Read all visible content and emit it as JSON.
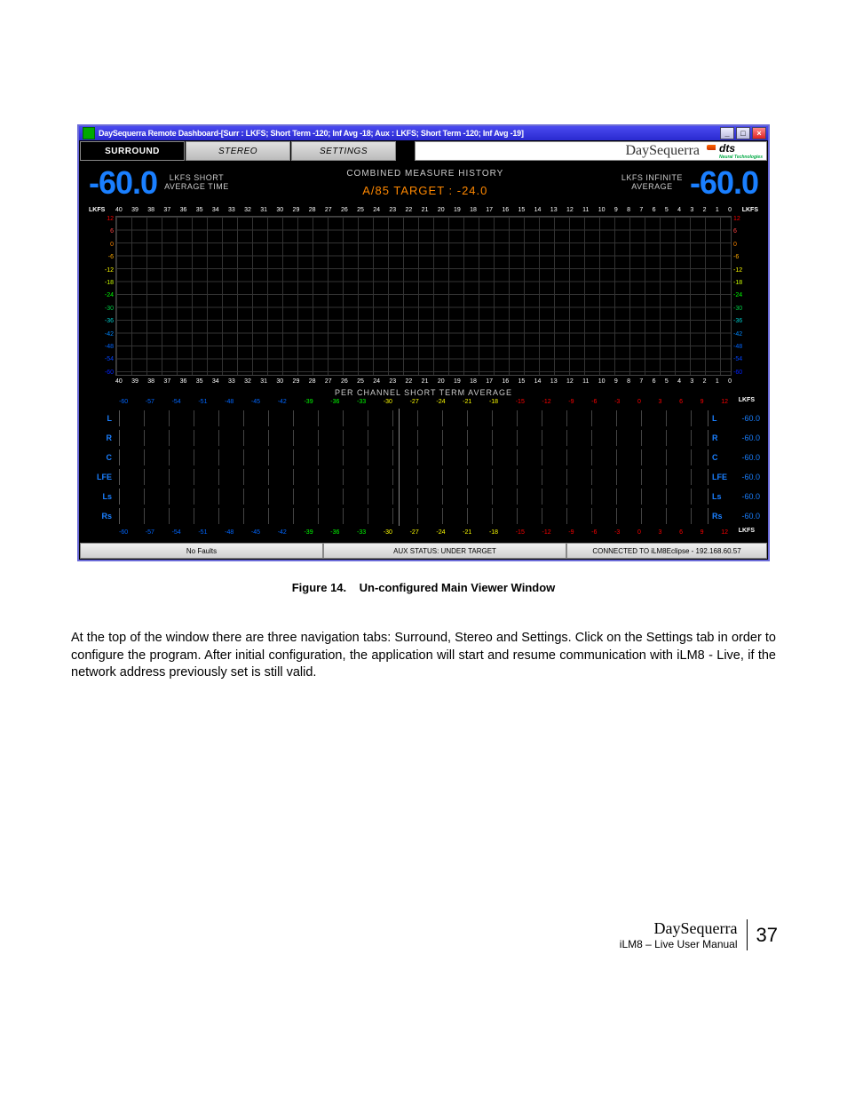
{
  "doc": {
    "caption_label": "Figure 14.",
    "caption_text": "Un-configured Main Viewer Window",
    "body_paragraph": "At the top of the window there are three navigation tabs: Surround, Stereo and Settings. Click on the Settings tab in order to configure the program. After initial configuration, the application will start and resume communication with iLM8 - Live, if the network address previously set is still valid.",
    "footer_brand": "DaySequerra",
    "footer_sub": "iLM8 – Live User Manual",
    "page_number": "37"
  },
  "window": {
    "title": "DaySequerra Remote Dashboard-[Surr : LKFS; Short Term -120; Inf Avg -18; Aux : LKFS; Short Term -120; Inf Avg -19]",
    "ctrl_min": "_",
    "ctrl_max": "□",
    "ctrl_close": "×"
  },
  "tabs": {
    "surround": "SURROUND",
    "stereo": "STEREO",
    "settings": "SETTINGS"
  },
  "branding": {
    "name": "DaySequerra",
    "partner": "dts",
    "partner_sub": "Neural Technologies"
  },
  "readings": {
    "short_label_l1": "LKFS SHORT",
    "short_label_l2": "AVERAGE TIME",
    "short_value": "-60.0",
    "inf_label_l1": "LKFS INFINITE",
    "inf_label_l2": "AVERAGE",
    "inf_value": "-60.0",
    "center_title": "COMBINED MEASURE HISTORY",
    "center_target": "A/85  TARGET : -24.0"
  },
  "graph": {
    "axis_unit": "LKFS",
    "x_ticks": [
      "40",
      "39",
      "38",
      "37",
      "36",
      "35",
      "34",
      "33",
      "32",
      "31",
      "30",
      "29",
      "28",
      "27",
      "26",
      "25",
      "24",
      "23",
      "22",
      "21",
      "20",
      "19",
      "18",
      "17",
      "16",
      "15",
      "14",
      "13",
      "12",
      "11",
      "10",
      "9",
      "8",
      "7",
      "6",
      "5",
      "4",
      "3",
      "2",
      "1",
      "0"
    ],
    "y_ticks": [
      "12",
      "6",
      "0",
      "-6",
      "-12",
      "-18",
      "-24",
      "-30",
      "-36",
      "-42",
      "-48",
      "-54",
      "-60"
    ]
  },
  "per_channel": {
    "title": "PER CHANNEL SHORT TERM AVERAGE",
    "unit": "LKFS",
    "scale": [
      "-60",
      "-57",
      "-54",
      "-51",
      "-48",
      "-45",
      "-42",
      "-39",
      "-36",
      "-33",
      "-30",
      "-27",
      "-24",
      "-21",
      "-18",
      "-15",
      "-12",
      "-9",
      "-6",
      "-3",
      "0",
      "3",
      "6",
      "9",
      "12"
    ],
    "channels": [
      {
        "name": "L",
        "value": "-60.0"
      },
      {
        "name": "R",
        "value": "-60.0"
      },
      {
        "name": "C",
        "value": "-60.0"
      },
      {
        "name": "LFE",
        "value": "-60.0"
      },
      {
        "name": "Ls",
        "value": "-60.0"
      },
      {
        "name": "Rs",
        "value": "-60.0"
      }
    ]
  },
  "status": {
    "faults": "No Faults",
    "aux": "AUX STATUS: UNDER TARGET",
    "conn": "CONNECTED TO iLM8Eclipse - 192.168.60.57"
  }
}
